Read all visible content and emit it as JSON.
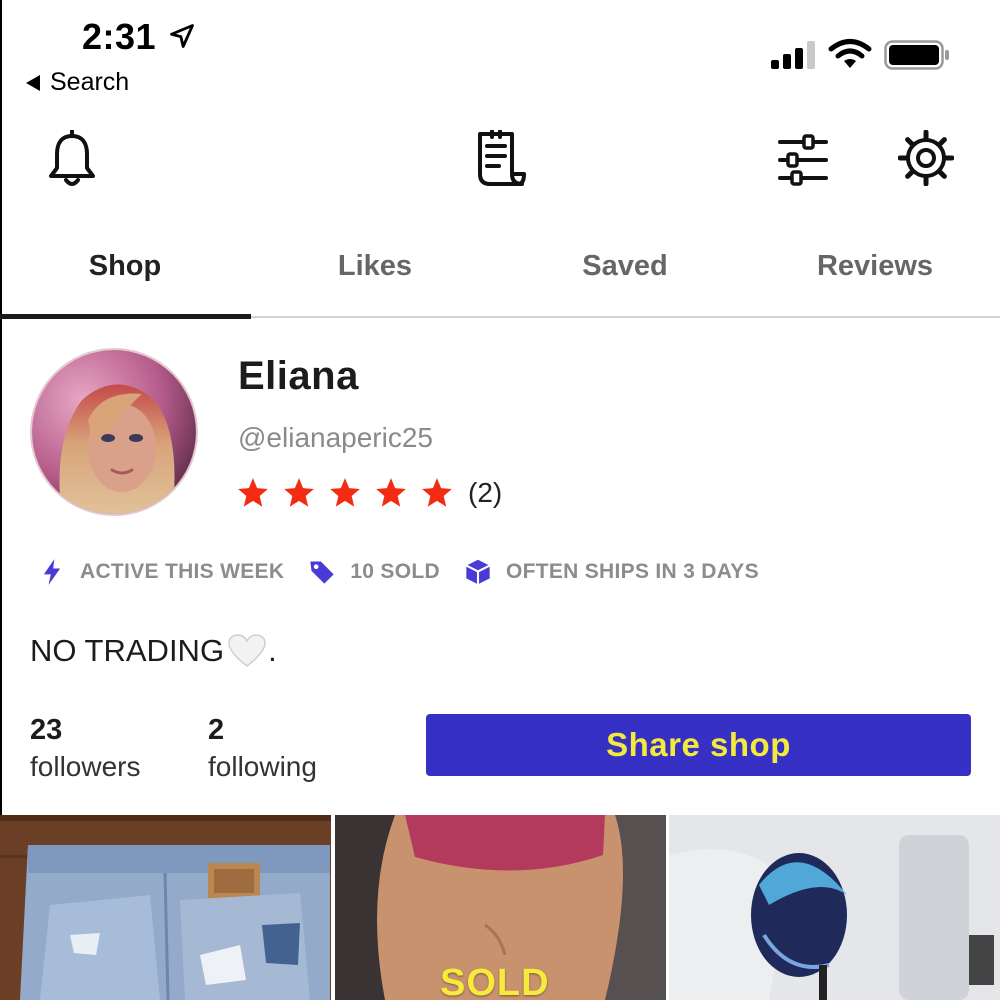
{
  "status_bar": {
    "time": "2:31",
    "back_label": "Search"
  },
  "toolbar": {
    "icons": [
      "bell-icon",
      "receipt-icon",
      "filters-icon",
      "gear-icon"
    ]
  },
  "tabs": [
    {
      "label": "Shop",
      "active": true
    },
    {
      "label": "Likes",
      "active": false
    },
    {
      "label": "Saved",
      "active": false
    },
    {
      "label": "Reviews",
      "active": false
    }
  ],
  "profile": {
    "name": "Eliana",
    "handle": "@elianaperic25",
    "rating_stars": 5,
    "review_count": "(2)",
    "badges": [
      {
        "icon": "lightning-icon",
        "label": "ACTIVE THIS WEEK"
      },
      {
        "icon": "tag-icon",
        "label": "10 SOLD"
      },
      {
        "icon": "box-icon",
        "label": "OFTEN SHIPS IN 3 DAYS"
      }
    ],
    "bio": "NO TRADING",
    "bio_end": ".",
    "followers": {
      "count": "23",
      "label": "followers"
    },
    "following": {
      "count": "2",
      "label": "following"
    },
    "share_button": "Share shop"
  },
  "grid": {
    "sold_label": "SOLD"
  },
  "colors": {
    "accent": "#3730c4",
    "button_text": "#f4ea3c",
    "star": "#f22b12",
    "badge_icon": "#4a3ad6"
  }
}
